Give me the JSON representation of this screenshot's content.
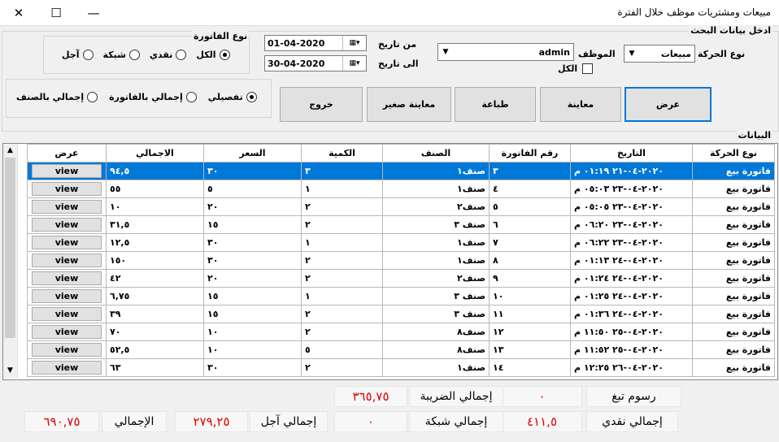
{
  "window": {
    "title": "مبيعات ومشتريات موظف خلال الفترة",
    "close": "✕",
    "maximize": "☐",
    "minimize": "—"
  },
  "search": {
    "group_label": "ادخل بيانات البحث",
    "movement_label": "نوع الحركة",
    "movement_value": "مبيعات",
    "employee_label": "الموظف",
    "employee_value": "admin",
    "all_label": "الكل",
    "from_label": "من تاريخ",
    "to_label": "الى تاريخ",
    "from_date": "01-04-2020",
    "to_date": "30-04-2020"
  },
  "invoice_type": {
    "label": "نوع الفاتورة",
    "options": [
      "الكل",
      "نقدي",
      "شبكة",
      "آجل"
    ],
    "selected": 0
  },
  "detail_type": {
    "options": [
      "تفصيلي",
      "إجمالي بالفاتورة",
      "إجمالي بالصنف"
    ],
    "selected": 0
  },
  "buttons": {
    "show": "عرض",
    "preview": "معاينة",
    "print": "طباعة",
    "preview_small": "معاينة صغير",
    "exit": "خروج"
  },
  "grid": {
    "label": "البيانات",
    "columns": [
      "نوع الحركة",
      "التاريخ",
      "رقم الفاتورة",
      "الصنف",
      "الكمية",
      "السعر",
      "الاجمالي",
      "عرض"
    ],
    "view_label": "view",
    "rows": [
      [
        "فاتورة بيع",
        "٢٠٢٠-٠٤-٢١ ٠١:١٩ م",
        "٣",
        "صنف١",
        "٣",
        "٣٠",
        "٩٤,٥"
      ],
      [
        "فاتورة بيع",
        "٢٠٢٠-٠٤-٢٣ ٠٥:٠٣ م",
        "٤",
        "صنف١",
        "١",
        "٥",
        "٥٥"
      ],
      [
        "فاتورة بيع",
        "٢٠٢٠-٠٤-٢٣ ٠٥:٠٥ م",
        "٥",
        "صنف٢",
        "٢",
        "٢٠",
        "١٠"
      ],
      [
        "فاتورة بيع",
        "٢٠٢٠-٠٤-٢٣ ٠٦:٢٠ م",
        "٦",
        "صنف ٣",
        "٢",
        "١٥",
        "٣١,٥"
      ],
      [
        "فاتورة بيع",
        "٢٠٢٠-٠٤-٢٣ ٠٦:٢٢ م",
        "٧",
        "صنف١",
        "١",
        "٣٠",
        "١٢,٥"
      ],
      [
        "فاتورة بيع",
        "٢٠٢٠-٠٤-٢٤ ٠١:١٣ م",
        "٨",
        "صنف١",
        "٢",
        "٣٠",
        "١٥٠"
      ],
      [
        "فاتورة بيع",
        "٢٠٢٠-٠٤-٢٤ ٠١:٢٤ م",
        "٩",
        "صنف٢",
        "٢",
        "٢٠",
        "٤٢"
      ],
      [
        "فاتورة بيع",
        "٢٠٢٠-٠٤-٢٤ ٠١:٢٥ م",
        "١٠",
        "صنف ٣",
        "١",
        "١٥",
        "٦,٧٥"
      ],
      [
        "فاتورة بيع",
        "٢٠٢٠-٠٤-٢٤ ٠١:٣٦ م",
        "١١",
        "صنف ٣",
        "٢",
        "١٥",
        "٣٩"
      ],
      [
        "فاتورة بيع",
        "٢٠٢٠-٠٤-٢٥ ١١:٥٠ م",
        "١٢",
        "صنف٨",
        "٢",
        "١٠",
        "٧٠"
      ],
      [
        "فاتورة بيع",
        "٢٠٢٠-٠٤-٢٥ ١١:٥٢ م",
        "١٣",
        "صنف٨",
        "٥",
        "١٠",
        "٥٢,٥"
      ],
      [
        "فاتورة بيع",
        "٢٠٢٠-٠٤-٢٦ ١٢:٢٥ م",
        "١٤",
        "صنف١",
        "٢",
        "٣٠",
        "٦٣"
      ]
    ]
  },
  "totals": {
    "tip_fees_label": "رسوم تبغ",
    "tip_fees_value": "٠",
    "tax_total_label": "إجمالي الضريبة",
    "tax_total_value": "٣٦٥,٧٥",
    "cash_total_label": "إجمالي نقدي",
    "cash_total_value": "٤١١,٥",
    "network_total_label": "إجمالي شبكة",
    "network_total_value": "٠",
    "credit_total_label": "إجمالي آجل",
    "credit_total_value": "٢٧٩,٢٥",
    "grand_total_label": "الإجمالي",
    "grand_total_value": "٦٩٠,٧٥"
  }
}
